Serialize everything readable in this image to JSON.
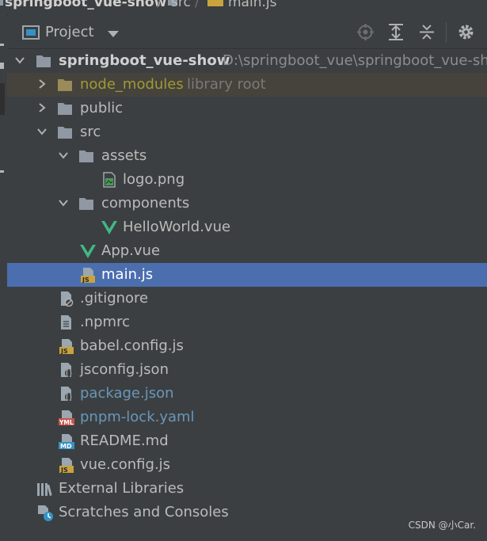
{
  "breadcrumb": {
    "project": "springboot_vue-show",
    "folder": "src",
    "file": "main.js"
  },
  "toolbar": {
    "title": "Project"
  },
  "root": {
    "name": "springboot_vue-show",
    "path": "D:\\springboot_vue\\springboot_vue-show"
  },
  "tree": {
    "node_modules": "node_modules",
    "library_root": "library root",
    "public": "public",
    "src": "src",
    "assets": "assets",
    "logo": "logo.png",
    "components": "components",
    "helloworld": "HelloWorld.vue",
    "app": "App.vue",
    "main": "main.js",
    "gitignore": ".gitignore",
    "npmrc": ".npmrc",
    "babel": "babel.config.js",
    "jsconfig": "jsconfig.json",
    "package": "package.json",
    "pnpm": "pnpm-lock.yaml",
    "readme": "README.md",
    "vueconfig": "vue.config.js"
  },
  "external_libraries": "External Libraries",
  "scratches": "Scratches and Consoles",
  "icon_text": {
    "js": "JS",
    "yml": "YML",
    "md": "MD"
  },
  "watermark": "CSDN @小Car.",
  "colors": {
    "bg": "#3c3f41",
    "selection": "#4b6eaf",
    "library_row": "#46433c",
    "vue_green": "#41b883",
    "js_yellow": "#c9a43d",
    "folder": "#8f98a3",
    "vcs_blue": "#6897bb",
    "excluded_olive": "#a09a36"
  }
}
